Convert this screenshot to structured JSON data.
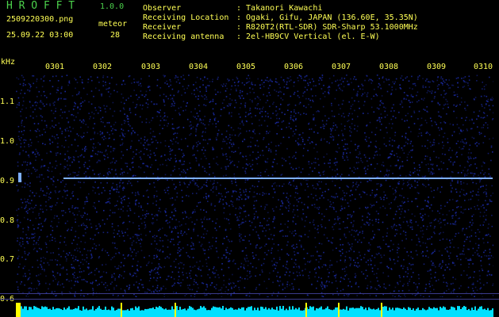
{
  "header": {
    "app_title": "H R O F F T",
    "version": "1.0.0",
    "filename": "2509220300.png",
    "datetime": "25.09.22 03:00",
    "meteor_label": "meteor",
    "meteor_count": "28"
  },
  "info": [
    {
      "key": "Observer",
      "value": ": Takanori Kawachi"
    },
    {
      "key": "Receiving Location",
      "value": ": Ogaki, Gifu, JAPAN (136.60E, 35.35N)"
    },
    {
      "key": "Receiver",
      "value": ": R820T2(RTL-SDR) SDR-Sharp 53.1000MHz"
    },
    {
      "key": "Receiving antenna",
      "value": ": 2el-HB9CV Vertical (el. E-W)"
    }
  ],
  "axis": {
    "unit": "kHz",
    "time_ticks": [
      "0301",
      "0302",
      "0303",
      "0304",
      "0305",
      "0306",
      "0307",
      "0308",
      "0309",
      "0310"
    ],
    "freq_ticks": [
      "1.1",
      "1.0",
      "0.9",
      "0.8",
      "0.7",
      "0.6"
    ]
  },
  "colors": {
    "background": "#000000",
    "noise": "#1c2ca8",
    "carrier": "#7fb0ff",
    "level": "#00e0ff",
    "peak": "#ffff00",
    "text": "#ffff55",
    "title": "#4cd24c"
  }
}
